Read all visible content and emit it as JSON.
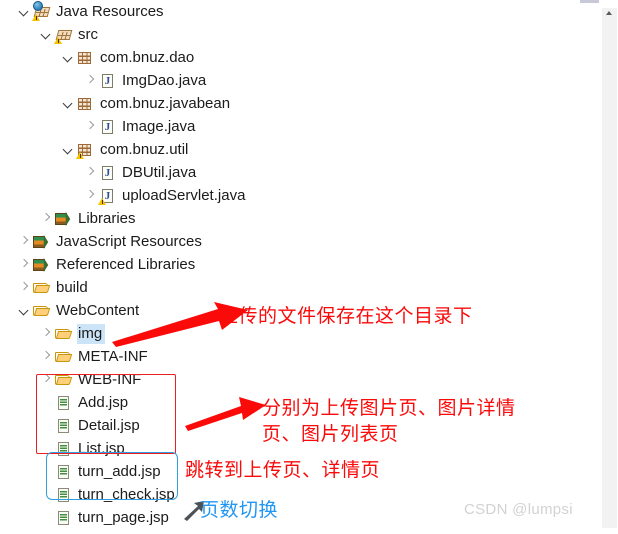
{
  "app": {
    "name": "eclipse-project-explorer",
    "selection_color": "#cce4f7"
  },
  "tree": {
    "items": [
      {
        "label": "Java Resources",
        "icon": "java-resources-icon",
        "indent": 0,
        "twisty": "open",
        "selected": false
      },
      {
        "label": "src",
        "icon": "source-folder-icon",
        "indent": 1,
        "twisty": "open",
        "selected": false
      },
      {
        "label": "com.bnuz.dao",
        "icon": "package-icon",
        "indent": 2,
        "twisty": "open",
        "selected": false
      },
      {
        "label": "ImgDao.java",
        "icon": "java-file-icon",
        "indent": 3,
        "twisty": "closed",
        "selected": false
      },
      {
        "label": "com.bnuz.javabean",
        "icon": "package-icon",
        "indent": 2,
        "twisty": "open",
        "selected": false
      },
      {
        "label": "Image.java",
        "icon": "java-file-icon",
        "indent": 3,
        "twisty": "closed",
        "selected": false
      },
      {
        "label": "com.bnuz.util",
        "icon": "package-warning-icon",
        "indent": 2,
        "twisty": "open",
        "selected": false
      },
      {
        "label": "DBUtil.java",
        "icon": "java-file-icon",
        "indent": 3,
        "twisty": "closed",
        "selected": false
      },
      {
        "label": "uploadServlet.java",
        "icon": "java-file-warning-icon",
        "indent": 3,
        "twisty": "closed",
        "selected": false
      },
      {
        "label": "Libraries",
        "icon": "libraries-icon",
        "indent": 1,
        "twisty": "closed",
        "selected": false
      },
      {
        "label": "JavaScript Resources",
        "icon": "libraries-icon",
        "indent": 0,
        "twisty": "closed",
        "selected": false
      },
      {
        "label": "Referenced Libraries",
        "icon": "libraries-icon",
        "indent": 0,
        "twisty": "closed",
        "selected": false
      },
      {
        "label": "build",
        "icon": "folder-icon",
        "indent": 0,
        "twisty": "closed",
        "selected": false
      },
      {
        "label": "WebContent",
        "icon": "folder-icon",
        "indent": 0,
        "twisty": "open",
        "selected": false
      },
      {
        "label": "img",
        "icon": "folder-icon",
        "indent": 1,
        "twisty": "closed",
        "selected": true
      },
      {
        "label": "META-INF",
        "icon": "folder-icon",
        "indent": 1,
        "twisty": "closed",
        "selected": false
      },
      {
        "label": "WEB-INF",
        "icon": "folder-icon",
        "indent": 1,
        "twisty": "closed",
        "selected": false
      },
      {
        "label": "Add.jsp",
        "icon": "jsp-file-icon",
        "indent": 1,
        "twisty": "none",
        "selected": false
      },
      {
        "label": "Detail.jsp",
        "icon": "jsp-file-icon",
        "indent": 1,
        "twisty": "none",
        "selected": false
      },
      {
        "label": "List.jsp",
        "icon": "jsp-file-icon",
        "indent": 1,
        "twisty": "none",
        "selected": false
      },
      {
        "label": "turn_add.jsp",
        "icon": "jsp-file-icon",
        "indent": 1,
        "twisty": "none",
        "selected": false
      },
      {
        "label": "turn_check.jsp",
        "icon": "jsp-file-icon",
        "indent": 1,
        "twisty": "none",
        "selected": false
      },
      {
        "label": "turn_page.jsp",
        "icon": "jsp-file-icon",
        "indent": 1,
        "twisty": "none",
        "selected": false
      }
    ]
  },
  "annotations": {
    "note_upload_dir": "上传的文件保存在这个目录下",
    "note_pages_line1": "分别为上传图片页、图片详情",
    "note_pages_line2": "页、图片列表页",
    "note_jump": "跳转到上传页、详情页",
    "note_paging": "页数切换",
    "color_red": "#fb0a0a",
    "color_blue": "#2196f3"
  },
  "watermark": {
    "text": "CSDN @lumpsi"
  }
}
